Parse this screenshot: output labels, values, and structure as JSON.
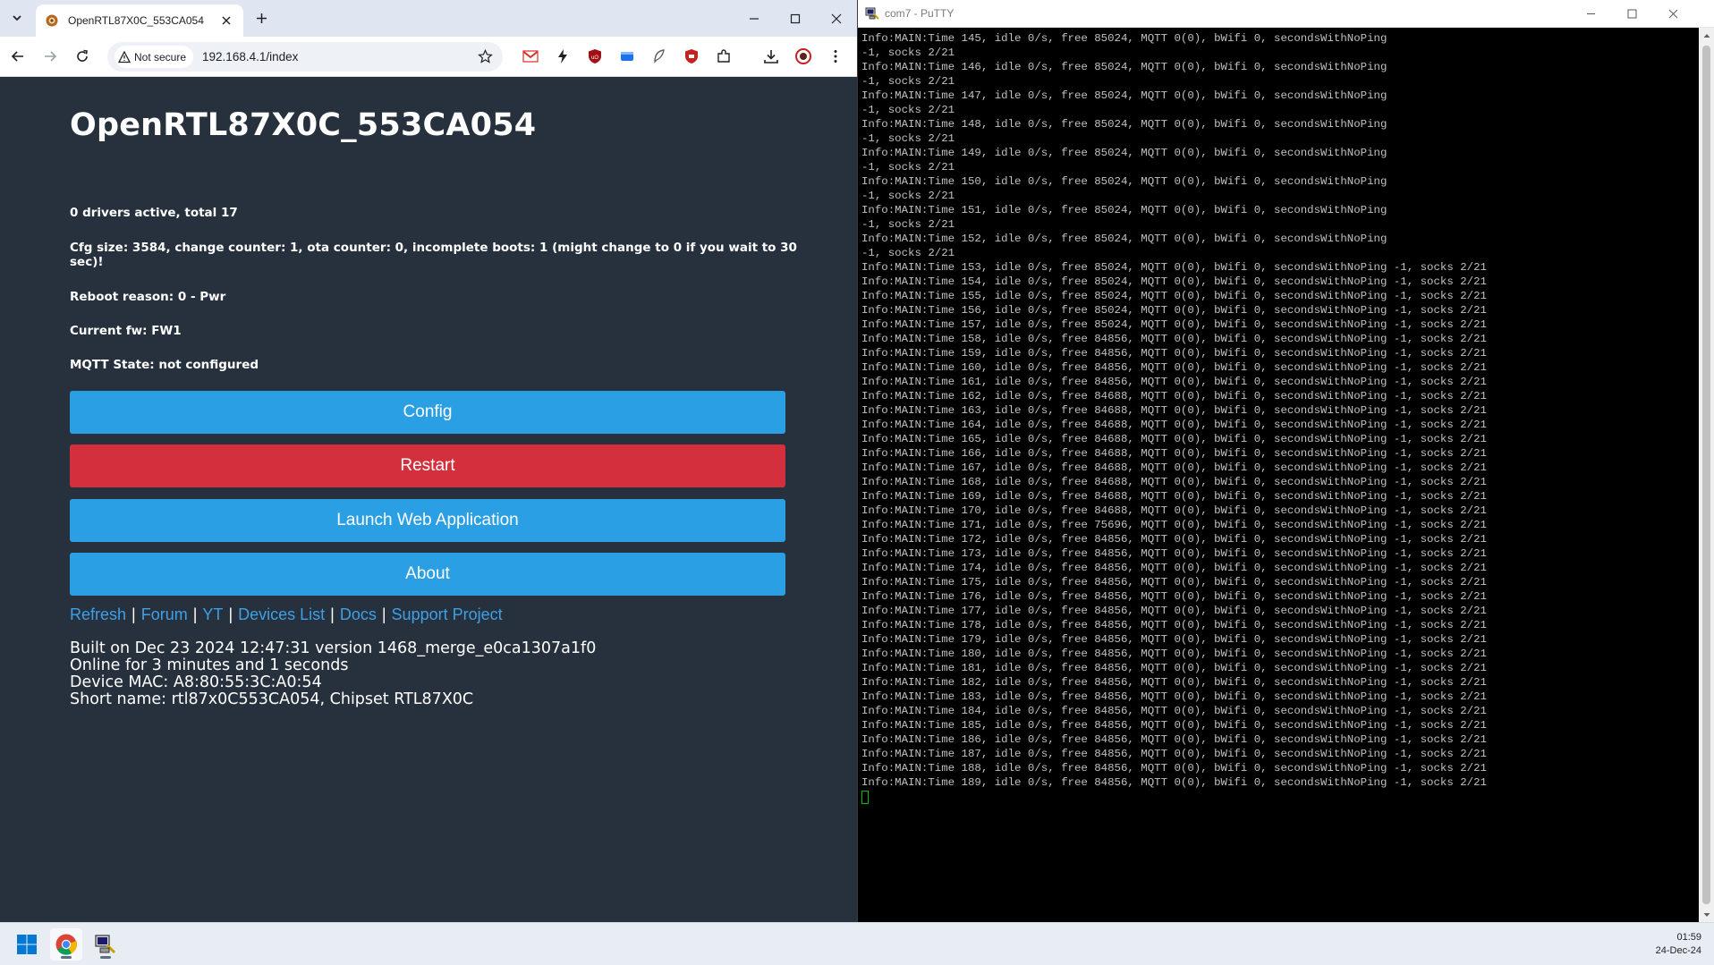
{
  "browser": {
    "tab": {
      "title": "OpenRTL87X0C_553CA054"
    },
    "security_label": "Not secure",
    "url": "192.168.4.1/index"
  },
  "page": {
    "title": "OpenRTL87X0C_553CA054",
    "drivers": "0 drivers active, total 17",
    "cfg": "Cfg size: 3584, change counter: 1, ota counter: 0, incomplete boots: 1 (might change to 0 if you wait to 30 sec)!",
    "reboot": "Reboot reason: 0 - Pwr",
    "firmware": "Current fw: FW1",
    "mqtt": "MQTT State: not configured",
    "buttons": {
      "config": "Config",
      "restart": "Restart",
      "launch": "Launch Web Application",
      "about": "About"
    },
    "links": [
      "Refresh",
      "Forum",
      "YT",
      "Devices List",
      "Docs",
      "Support Project"
    ],
    "link_separator": "|",
    "build": "Built on Dec 23 2024 12:47:31 version 1468_merge_e0ca1307a1f0",
    "online": "Online for 3 minutes and 1 seconds",
    "mac": "Device MAC: A8:80:55:3C:A0:54",
    "shortname": "Short name: rtl87x0C553CA054, Chipset RTL87X0C"
  },
  "putty": {
    "title": "com7 - PuTTY",
    "lines": [
      "Info:MAIN:Time 145, idle 0/s, free 85024, MQTT 0(0), bWifi 0, secondsWithNoPing",
      "-1, socks 2/21",
      "Info:MAIN:Time 146, idle 0/s, free 85024, MQTT 0(0), bWifi 0, secondsWithNoPing",
      "-1, socks 2/21",
      "Info:MAIN:Time 147, idle 0/s, free 85024, MQTT 0(0), bWifi 0, secondsWithNoPing",
      "-1, socks 2/21",
      "Info:MAIN:Time 148, idle 0/s, free 85024, MQTT 0(0), bWifi 0, secondsWithNoPing",
      "-1, socks 2/21",
      "Info:MAIN:Time 149, idle 0/s, free 85024, MQTT 0(0), bWifi 0, secondsWithNoPing",
      "-1, socks 2/21",
      "Info:MAIN:Time 150, idle 0/s, free 85024, MQTT 0(0), bWifi 0, secondsWithNoPing",
      "-1, socks 2/21",
      "Info:MAIN:Time 151, idle 0/s, free 85024, MQTT 0(0), bWifi 0, secondsWithNoPing",
      "-1, socks 2/21",
      "Info:MAIN:Time 152, idle 0/s, free 85024, MQTT 0(0), bWifi 0, secondsWithNoPing",
      "-1, socks 2/21",
      "Info:MAIN:Time 153, idle 0/s, free 85024, MQTT 0(0), bWifi 0, secondsWithNoPing -1, socks 2/21",
      "Info:MAIN:Time 154, idle 0/s, free 85024, MQTT 0(0), bWifi 0, secondsWithNoPing -1, socks 2/21",
      "Info:MAIN:Time 155, idle 0/s, free 85024, MQTT 0(0), bWifi 0, secondsWithNoPing -1, socks 2/21",
      "Info:MAIN:Time 156, idle 0/s, free 85024, MQTT 0(0), bWifi 0, secondsWithNoPing -1, socks 2/21",
      "Info:MAIN:Time 157, idle 0/s, free 85024, MQTT 0(0), bWifi 0, secondsWithNoPing -1, socks 2/21",
      "Info:MAIN:Time 158, idle 0/s, free 84856, MQTT 0(0), bWifi 0, secondsWithNoPing -1, socks 2/21",
      "Info:MAIN:Time 159, idle 0/s, free 84856, MQTT 0(0), bWifi 0, secondsWithNoPing -1, socks 2/21",
      "Info:MAIN:Time 160, idle 0/s, free 84856, MQTT 0(0), bWifi 0, secondsWithNoPing -1, socks 2/21",
      "Info:MAIN:Time 161, idle 0/s, free 84856, MQTT 0(0), bWifi 0, secondsWithNoPing -1, socks 2/21",
      "Info:MAIN:Time 162, idle 0/s, free 84688, MQTT 0(0), bWifi 0, secondsWithNoPing -1, socks 2/21",
      "Info:MAIN:Time 163, idle 0/s, free 84688, MQTT 0(0), bWifi 0, secondsWithNoPing -1, socks 2/21",
      "Info:MAIN:Time 164, idle 0/s, free 84688, MQTT 0(0), bWifi 0, secondsWithNoPing -1, socks 2/21",
      "Info:MAIN:Time 165, idle 0/s, free 84688, MQTT 0(0), bWifi 0, secondsWithNoPing -1, socks 2/21",
      "Info:MAIN:Time 166, idle 0/s, free 84688, MQTT 0(0), bWifi 0, secondsWithNoPing -1, socks 2/21",
      "Info:MAIN:Time 167, idle 0/s, free 84688, MQTT 0(0), bWifi 0, secondsWithNoPing -1, socks 2/21",
      "Info:MAIN:Time 168, idle 0/s, free 84688, MQTT 0(0), bWifi 0, secondsWithNoPing -1, socks 2/21",
      "Info:MAIN:Time 169, idle 0/s, free 84688, MQTT 0(0), bWifi 0, secondsWithNoPing -1, socks 2/21",
      "Info:MAIN:Time 170, idle 0/s, free 84688, MQTT 0(0), bWifi 0, secondsWithNoPing -1, socks 2/21",
      "Info:MAIN:Time 171, idle 0/s, free 75696, MQTT 0(0), bWifi 0, secondsWithNoPing -1, socks 2/21",
      "Info:MAIN:Time 172, idle 0/s, free 84856, MQTT 0(0), bWifi 0, secondsWithNoPing -1, socks 2/21",
      "Info:MAIN:Time 173, idle 0/s, free 84856, MQTT 0(0), bWifi 0, secondsWithNoPing -1, socks 2/21",
      "Info:MAIN:Time 174, idle 0/s, free 84856, MQTT 0(0), bWifi 0, secondsWithNoPing -1, socks 2/21",
      "Info:MAIN:Time 175, idle 0/s, free 84856, MQTT 0(0), bWifi 0, secondsWithNoPing -1, socks 2/21",
      "Info:MAIN:Time 176, idle 0/s, free 84856, MQTT 0(0), bWifi 0, secondsWithNoPing -1, socks 2/21",
      "Info:MAIN:Time 177, idle 0/s, free 84856, MQTT 0(0), bWifi 0, secondsWithNoPing -1, socks 2/21",
      "Info:MAIN:Time 178, idle 0/s, free 84856, MQTT 0(0), bWifi 0, secondsWithNoPing -1, socks 2/21",
      "Info:MAIN:Time 179, idle 0/s, free 84856, MQTT 0(0), bWifi 0, secondsWithNoPing -1, socks 2/21",
      "Info:MAIN:Time 180, idle 0/s, free 84856, MQTT 0(0), bWifi 0, secondsWithNoPing -1, socks 2/21",
      "Info:MAIN:Time 181, idle 0/s, free 84856, MQTT 0(0), bWifi 0, secondsWithNoPing -1, socks 2/21",
      "Info:MAIN:Time 182, idle 0/s, free 84856, MQTT 0(0), bWifi 0, secondsWithNoPing -1, socks 2/21",
      "Info:MAIN:Time 183, idle 0/s, free 84856, MQTT 0(0), bWifi 0, secondsWithNoPing -1, socks 2/21",
      "Info:MAIN:Time 184, idle 0/s, free 84856, MQTT 0(0), bWifi 0, secondsWithNoPing -1, socks 2/21",
      "Info:MAIN:Time 185, idle 0/s, free 84856, MQTT 0(0), bWifi 0, secondsWithNoPing -1, socks 2/21",
      "Info:MAIN:Time 186, idle 0/s, free 84856, MQTT 0(0), bWifi 0, secondsWithNoPing -1, socks 2/21",
      "Info:MAIN:Time 187, idle 0/s, free 84856, MQTT 0(0), bWifi 0, secondsWithNoPing -1, socks 2/21",
      "Info:MAIN:Time 188, idle 0/s, free 84856, MQTT 0(0), bWifi 0, secondsWithNoPing -1, socks 2/21",
      "Info:MAIN:Time 189, idle 0/s, free 84856, MQTT 0(0), bWifi 0, secondsWithNoPing -1, socks 2/21"
    ]
  },
  "taskbar": {
    "time": "01:59",
    "date": "24-Dec-24"
  },
  "icons": {
    "tab_search": "chevron-down-icon",
    "favicon": "gear-icon",
    "close": "close-icon",
    "new_tab": "plus-icon",
    "back": "arrow-left-icon",
    "forward": "arrow-right-icon",
    "reload": "reload-icon",
    "warning": "warning-icon",
    "star": "star-icon",
    "download": "download-icon",
    "menu": "kebab-menu-icon"
  },
  "colors": {
    "page_bg": "#26313d",
    "button_blue": "#2b9fe3",
    "button_red": "#d32f3d",
    "link": "#3ea0e6",
    "terminal_text": "#c0c0c0",
    "cursor": "#00c000"
  }
}
